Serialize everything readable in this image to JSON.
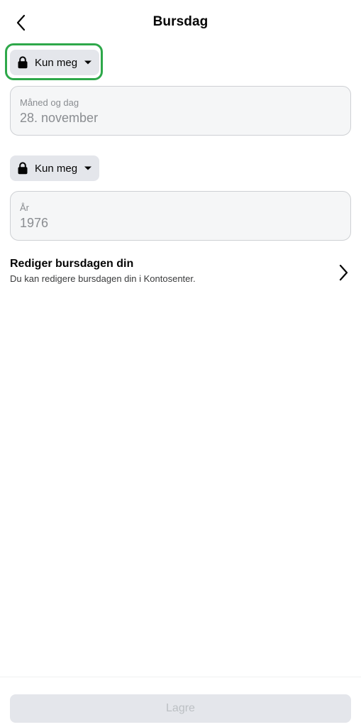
{
  "header": {
    "title": "Bursdag",
    "back_icon": "chevron-left-icon"
  },
  "birthday_date": {
    "privacy": {
      "label": "Kun meg",
      "icon": "lock-icon",
      "caret_icon": "caret-down-icon"
    },
    "field": {
      "label": "Måned og dag",
      "value": "28. november"
    }
  },
  "birthday_year": {
    "privacy": {
      "label": "Kun meg",
      "icon": "lock-icon",
      "caret_icon": "caret-down-icon"
    },
    "field": {
      "label": "År",
      "value": "1976"
    }
  },
  "edit_birthday": {
    "title": "Rediger bursdagen din",
    "subtitle": "Du kan redigere bursdagen din i Kontosenter.",
    "icon": "chevron-right-icon"
  },
  "footer": {
    "save_label": "Lagre",
    "save_enabled": false
  },
  "colors": {
    "highlight": "#2ea84a",
    "pill_bg": "#e4e6eb",
    "field_bg": "#f5f6f7",
    "field_border": "#ced0d4",
    "muted_text": "#8a8d91",
    "disabled_text": "#bcc0c4"
  }
}
